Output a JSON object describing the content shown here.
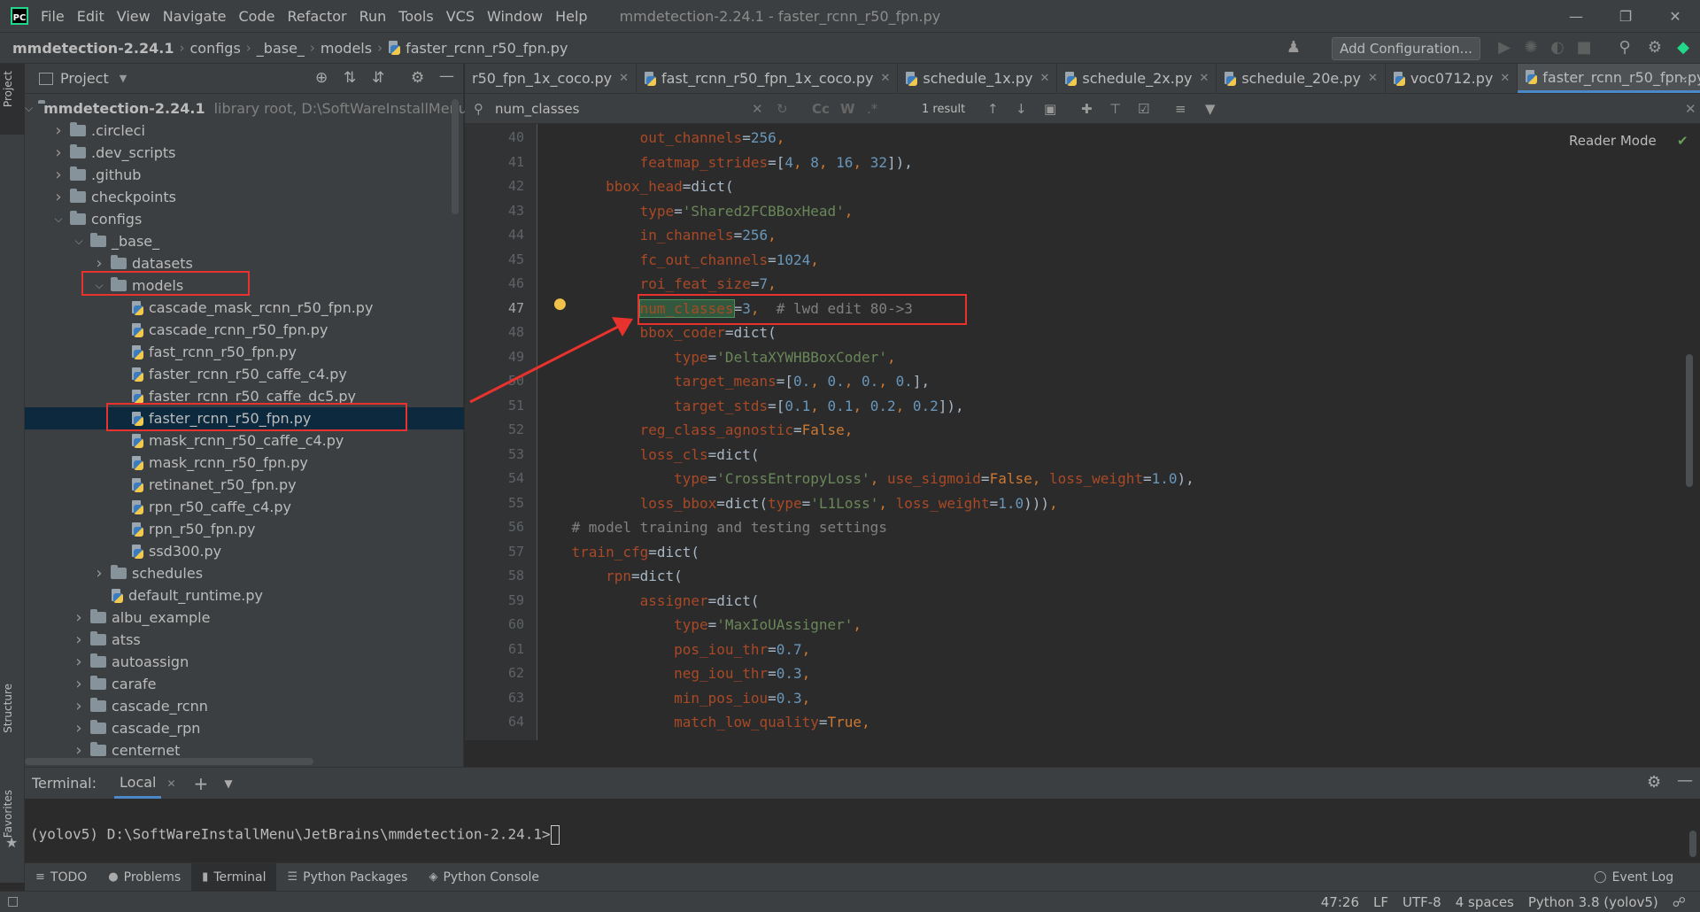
{
  "title_bar": {
    "menu": [
      "File",
      "Edit",
      "View",
      "Navigate",
      "Code",
      "Refactor",
      "Run",
      "Tools",
      "VCS",
      "Window",
      "Help"
    ],
    "window_title": "mmdetection-2.24.1 - faster_rcnn_r50_fpn.py",
    "logo_text": "PC"
  },
  "nav": {
    "crumbs": [
      "mmdetection-2.24.1",
      "configs",
      "_base_",
      "models",
      "faster_rcnn_r50_fpn.py"
    ],
    "add_config": "Add Configuration..."
  },
  "left_stripe": {
    "project": "Project",
    "structure": "Structure",
    "favorites": "Favorites"
  },
  "project": {
    "title": "Project",
    "tree": [
      {
        "label": "mmdetection-2.24.1",
        "note": "library root, D:\\SoftWareInstallMenu\\Je",
        "depth": 0,
        "type": "folder",
        "open": true
      },
      {
        "label": ".circleci",
        "depth": 1,
        "type": "folder",
        "open": false
      },
      {
        "label": ".dev_scripts",
        "depth": 1,
        "type": "folder",
        "open": false
      },
      {
        "label": ".github",
        "depth": 1,
        "type": "folder",
        "open": false
      },
      {
        "label": "checkpoints",
        "depth": 1,
        "type": "folder",
        "open": false
      },
      {
        "label": "configs",
        "depth": 1,
        "type": "folder",
        "open": true
      },
      {
        "label": "_base_",
        "depth": 2,
        "type": "folder",
        "open": true
      },
      {
        "label": "datasets",
        "depth": 3,
        "type": "folder",
        "open": false
      },
      {
        "label": "models",
        "depth": 3,
        "type": "folder",
        "open": true
      },
      {
        "label": "cascade_mask_rcnn_r50_fpn.py",
        "depth": 4,
        "type": "file"
      },
      {
        "label": "cascade_rcnn_r50_fpn.py",
        "depth": 4,
        "type": "file"
      },
      {
        "label": "fast_rcnn_r50_fpn.py",
        "depth": 4,
        "type": "file"
      },
      {
        "label": "faster_rcnn_r50_caffe_c4.py",
        "depth": 4,
        "type": "file"
      },
      {
        "label": "faster_rcnn_r50_caffe_dc5.py",
        "depth": 4,
        "type": "file"
      },
      {
        "label": "faster_rcnn_r50_fpn.py",
        "depth": 4,
        "type": "file",
        "selected": true
      },
      {
        "label": "mask_rcnn_r50_caffe_c4.py",
        "depth": 4,
        "type": "file"
      },
      {
        "label": "mask_rcnn_r50_fpn.py",
        "depth": 4,
        "type": "file"
      },
      {
        "label": "retinanet_r50_fpn.py",
        "depth": 4,
        "type": "file"
      },
      {
        "label": "rpn_r50_caffe_c4.py",
        "depth": 4,
        "type": "file"
      },
      {
        "label": "rpn_r50_fpn.py",
        "depth": 4,
        "type": "file"
      },
      {
        "label": "ssd300.py",
        "depth": 4,
        "type": "file"
      },
      {
        "label": "schedules",
        "depth": 3,
        "type": "folder",
        "open": false
      },
      {
        "label": "default_runtime.py",
        "depth": 3,
        "type": "file"
      },
      {
        "label": "albu_example",
        "depth": 2,
        "type": "folder",
        "open": false
      },
      {
        "label": "atss",
        "depth": 2,
        "type": "folder",
        "open": false
      },
      {
        "label": "autoassign",
        "depth": 2,
        "type": "folder",
        "open": false
      },
      {
        "label": "carafe",
        "depth": 2,
        "type": "folder",
        "open": false
      },
      {
        "label": "cascade_rcnn",
        "depth": 2,
        "type": "folder",
        "open": false
      },
      {
        "label": "cascade_rpn",
        "depth": 2,
        "type": "folder",
        "open": false
      },
      {
        "label": "centernet",
        "depth": 2,
        "type": "folder",
        "open": false
      }
    ]
  },
  "tabs": [
    {
      "label": "r50_fpn_1x_coco.py"
    },
    {
      "label": "fast_rcnn_r50_fpn_1x_coco.py"
    },
    {
      "label": "schedule_1x.py"
    },
    {
      "label": "schedule_2x.py"
    },
    {
      "label": "schedule_20e.py"
    },
    {
      "label": "voc0712.py"
    },
    {
      "label": "faster_rcnn_r50_fpn.py",
      "active": true
    }
  ],
  "search": {
    "value": "num_classes",
    "result": "1 result",
    "cc": "Cc",
    "w": "W",
    "regex": ".*"
  },
  "editor": {
    "reader_mode": "Reader Mode",
    "current_line": 47,
    "lines": [
      {
        "n": "40",
        "tokens": [
          [
            "            ",
            ""
          ],
          [
            "out_channels",
            "param"
          ],
          [
            "=",
            ""
          ],
          [
            "256",
            "num"
          ],
          [
            ",",
            "kw"
          ]
        ]
      },
      {
        "n": "41",
        "tokens": [
          [
            "            ",
            ""
          ],
          [
            "featmap_strides",
            "param"
          ],
          [
            "=[",
            ""
          ],
          [
            "4",
            "num"
          ],
          [
            ", ",
            "kw"
          ],
          [
            "8",
            "num"
          ],
          [
            ", ",
            "kw"
          ],
          [
            "16",
            "num"
          ],
          [
            ", ",
            "kw"
          ],
          [
            "32",
            "num"
          ],
          [
            "]),",
            ""
          ]
        ]
      },
      {
        "n": "42",
        "tokens": [
          [
            "        ",
            ""
          ],
          [
            "bbox_head",
            "param"
          ],
          [
            "=",
            ""
          ],
          [
            "dict",
            "fn"
          ],
          [
            "(",
            ""
          ]
        ]
      },
      {
        "n": "43",
        "tokens": [
          [
            "            ",
            ""
          ],
          [
            "type",
            "param"
          ],
          [
            "=",
            ""
          ],
          [
            "'Shared2FCBBoxHead'",
            "str"
          ],
          [
            ",",
            "kw"
          ]
        ]
      },
      {
        "n": "44",
        "tokens": [
          [
            "            ",
            ""
          ],
          [
            "in_channels",
            "param"
          ],
          [
            "=",
            ""
          ],
          [
            "256",
            "num"
          ],
          [
            ",",
            "kw"
          ]
        ]
      },
      {
        "n": "45",
        "tokens": [
          [
            "            ",
            ""
          ],
          [
            "fc_out_channels",
            "param"
          ],
          [
            "=",
            ""
          ],
          [
            "1024",
            "num"
          ],
          [
            ",",
            "kw"
          ]
        ]
      },
      {
        "n": "46",
        "tokens": [
          [
            "            ",
            ""
          ],
          [
            "roi_feat_size",
            "param"
          ],
          [
            "=",
            ""
          ],
          [
            "7",
            "num"
          ],
          [
            ",",
            "kw"
          ]
        ]
      },
      {
        "n": "47",
        "tokens": [
          [
            "            ",
            ""
          ],
          [
            "num_classes",
            "param hl"
          ],
          [
            "=",
            ""
          ],
          [
            "3",
            "num"
          ],
          [
            ",  ",
            "kw"
          ],
          [
            "# lwd edit 80->3",
            "cmt"
          ]
        ]
      },
      {
        "n": "48",
        "tokens": [
          [
            "            ",
            ""
          ],
          [
            "bbox_coder",
            "param"
          ],
          [
            "=",
            ""
          ],
          [
            "dict",
            "fn"
          ],
          [
            "(",
            ""
          ]
        ]
      },
      {
        "n": "49",
        "tokens": [
          [
            "                ",
            ""
          ],
          [
            "type",
            "param"
          ],
          [
            "=",
            ""
          ],
          [
            "'DeltaXYWHBBoxCoder'",
            "str"
          ],
          [
            ",",
            "kw"
          ]
        ]
      },
      {
        "n": "50",
        "tokens": [
          [
            "                ",
            ""
          ],
          [
            "target_means",
            "param"
          ],
          [
            "=[",
            ""
          ],
          [
            "0.",
            "num"
          ],
          [
            ", ",
            "kw"
          ],
          [
            "0.",
            "num"
          ],
          [
            ", ",
            "kw"
          ],
          [
            "0.",
            "num"
          ],
          [
            ", ",
            "kw"
          ],
          [
            "0.",
            "num"
          ],
          [
            "],",
            ""
          ]
        ]
      },
      {
        "n": "51",
        "tokens": [
          [
            "                ",
            ""
          ],
          [
            "target_stds",
            "param"
          ],
          [
            "=[",
            ""
          ],
          [
            "0.1",
            "num"
          ],
          [
            ", ",
            "kw"
          ],
          [
            "0.1",
            "num"
          ],
          [
            ", ",
            "kw"
          ],
          [
            "0.2",
            "num"
          ],
          [
            ", ",
            "kw"
          ],
          [
            "0.2",
            "num"
          ],
          [
            "]),",
            ""
          ]
        ]
      },
      {
        "n": "52",
        "tokens": [
          [
            "            ",
            ""
          ],
          [
            "reg_class_agnostic",
            "param"
          ],
          [
            "=",
            ""
          ],
          [
            "False",
            "kw"
          ],
          [
            ",",
            "kw"
          ]
        ]
      },
      {
        "n": "53",
        "tokens": [
          [
            "            ",
            ""
          ],
          [
            "loss_cls",
            "param"
          ],
          [
            "=",
            ""
          ],
          [
            "dict",
            "fn"
          ],
          [
            "(",
            ""
          ]
        ]
      },
      {
        "n": "54",
        "tokens": [
          [
            "                ",
            ""
          ],
          [
            "type",
            "param"
          ],
          [
            "=",
            ""
          ],
          [
            "'CrossEntropyLoss'",
            "str"
          ],
          [
            ", ",
            "kw"
          ],
          [
            "use_sigmoid",
            "param"
          ],
          [
            "=",
            ""
          ],
          [
            "False",
            "kw"
          ],
          [
            ", ",
            "kw"
          ],
          [
            "loss_weight",
            "param"
          ],
          [
            "=",
            ""
          ],
          [
            "1.0",
            "num"
          ],
          [
            "),",
            ""
          ]
        ]
      },
      {
        "n": "55",
        "tokens": [
          [
            "            ",
            ""
          ],
          [
            "loss_bbox",
            "param"
          ],
          [
            "=",
            ""
          ],
          [
            "dict",
            "fn"
          ],
          [
            "(",
            ""
          ],
          [
            "type",
            "param"
          ],
          [
            "=",
            ""
          ],
          [
            "'L1Loss'",
            "str"
          ],
          [
            ", ",
            "kw"
          ],
          [
            "loss_weight",
            "param"
          ],
          [
            "=",
            ""
          ],
          [
            "1.0",
            "num"
          ],
          [
            ")))",
            ""
          ],
          [
            ",",
            "kw"
          ]
        ]
      },
      {
        "n": "56",
        "tokens": [
          [
            "    ",
            ""
          ],
          [
            "# model training and testing settings",
            "cmt"
          ]
        ]
      },
      {
        "n": "57",
        "tokens": [
          [
            "    ",
            ""
          ],
          [
            "train_cfg",
            "param"
          ],
          [
            "=",
            ""
          ],
          [
            "dict",
            "fn"
          ],
          [
            "(",
            ""
          ]
        ]
      },
      {
        "n": "58",
        "tokens": [
          [
            "        ",
            ""
          ],
          [
            "rpn",
            "param"
          ],
          [
            "=",
            ""
          ],
          [
            "dict",
            "fn"
          ],
          [
            "(",
            ""
          ]
        ]
      },
      {
        "n": "59",
        "tokens": [
          [
            "            ",
            ""
          ],
          [
            "assigner",
            "param"
          ],
          [
            "=",
            ""
          ],
          [
            "dict",
            "fn"
          ],
          [
            "(",
            ""
          ]
        ]
      },
      {
        "n": "60",
        "tokens": [
          [
            "                ",
            ""
          ],
          [
            "type",
            "param"
          ],
          [
            "=",
            ""
          ],
          [
            "'MaxIoUAssigner'",
            "str"
          ],
          [
            ",",
            "kw"
          ]
        ]
      },
      {
        "n": "61",
        "tokens": [
          [
            "                ",
            ""
          ],
          [
            "pos_iou_thr",
            "param"
          ],
          [
            "=",
            ""
          ],
          [
            "0.7",
            "num"
          ],
          [
            ",",
            "kw"
          ]
        ]
      },
      {
        "n": "62",
        "tokens": [
          [
            "                ",
            ""
          ],
          [
            "neg_iou_thr",
            "param"
          ],
          [
            "=",
            ""
          ],
          [
            "0.3",
            "num"
          ],
          [
            ",",
            "kw"
          ]
        ]
      },
      {
        "n": "63",
        "tokens": [
          [
            "                ",
            ""
          ],
          [
            "min_pos_iou",
            "param"
          ],
          [
            "=",
            ""
          ],
          [
            "0.3",
            "num"
          ],
          [
            ",",
            "kw"
          ]
        ]
      },
      {
        "n": "64",
        "tokens": [
          [
            "                ",
            ""
          ],
          [
            "match_low_quality",
            "param"
          ],
          [
            "=",
            ""
          ],
          [
            "True",
            "kw"
          ],
          [
            ",",
            "kw"
          ]
        ]
      }
    ]
  },
  "terminal": {
    "label": "Terminal:",
    "tab": "Local",
    "prompt": "(yolov5) D:\\SoftWareInstallMenu\\JetBrains\\mmdetection-2.24.1>"
  },
  "tool_tabs": [
    {
      "label": "TODO",
      "icon": "list-icon"
    },
    {
      "label": "Problems",
      "icon": "info-icon"
    },
    {
      "label": "Terminal",
      "icon": "terminal-icon",
      "active": true
    },
    {
      "label": "Python Packages",
      "icon": "packages-icon"
    },
    {
      "label": "Python Console",
      "icon": "console-icon"
    }
  ],
  "event_log": "Event Log",
  "status": {
    "position": "47:26",
    "line_sep": "LF",
    "encoding": "UTF-8",
    "indent": "4 spaces",
    "interpreter": "Python 3.8 (yolov5)"
  },
  "colors": {
    "accent": "#4a88c7",
    "annotation_red": "#e8322d",
    "highlight": "#32593d"
  }
}
